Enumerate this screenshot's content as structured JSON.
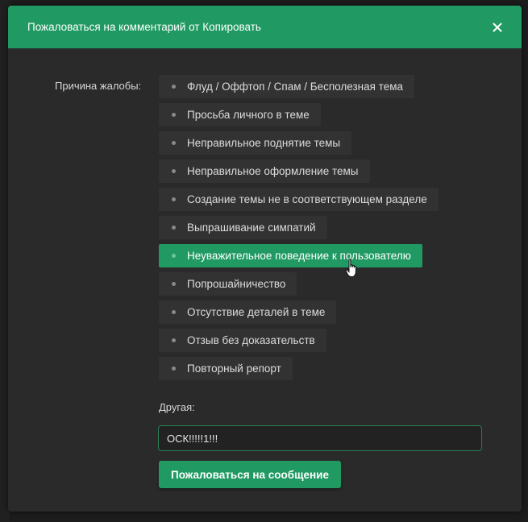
{
  "modal": {
    "title": "Пожаловаться на комментарий от Копировать",
    "close_icon": "close-icon",
    "reasons_label": "Причина жалобы:",
    "reasons": [
      {
        "label": "Флуд / Оффтоп / Спам / Бесполезная тема",
        "selected": false
      },
      {
        "label": "Просьба личного в теме",
        "selected": false
      },
      {
        "label": "Неправильное поднятие темы",
        "selected": false
      },
      {
        "label": "Неправильное оформление темы",
        "selected": false
      },
      {
        "label": "Создание темы не в соответствующем разделе",
        "selected": false
      },
      {
        "label": "Выпрашивание симпатий",
        "selected": false
      },
      {
        "label": "Неуважительное поведение к пользователю",
        "selected": true
      },
      {
        "label": "Попрошайничество",
        "selected": false
      },
      {
        "label": "Отсутствие деталей в теме",
        "selected": false
      },
      {
        "label": "Отзыв без доказательств",
        "selected": false
      },
      {
        "label": "Повторный репорт",
        "selected": false
      }
    ],
    "other_label": "Другая:",
    "other_value": "ОСК!!!!!1!!!",
    "submit_label": "Пожаловаться на сообщение"
  },
  "colors": {
    "accent": "#209a62",
    "modal_bg": "#2a2a2a",
    "page_bg": "#1c1c1c",
    "chip_bg": "#323232"
  },
  "cursor_icon": "hand-pointer-icon"
}
